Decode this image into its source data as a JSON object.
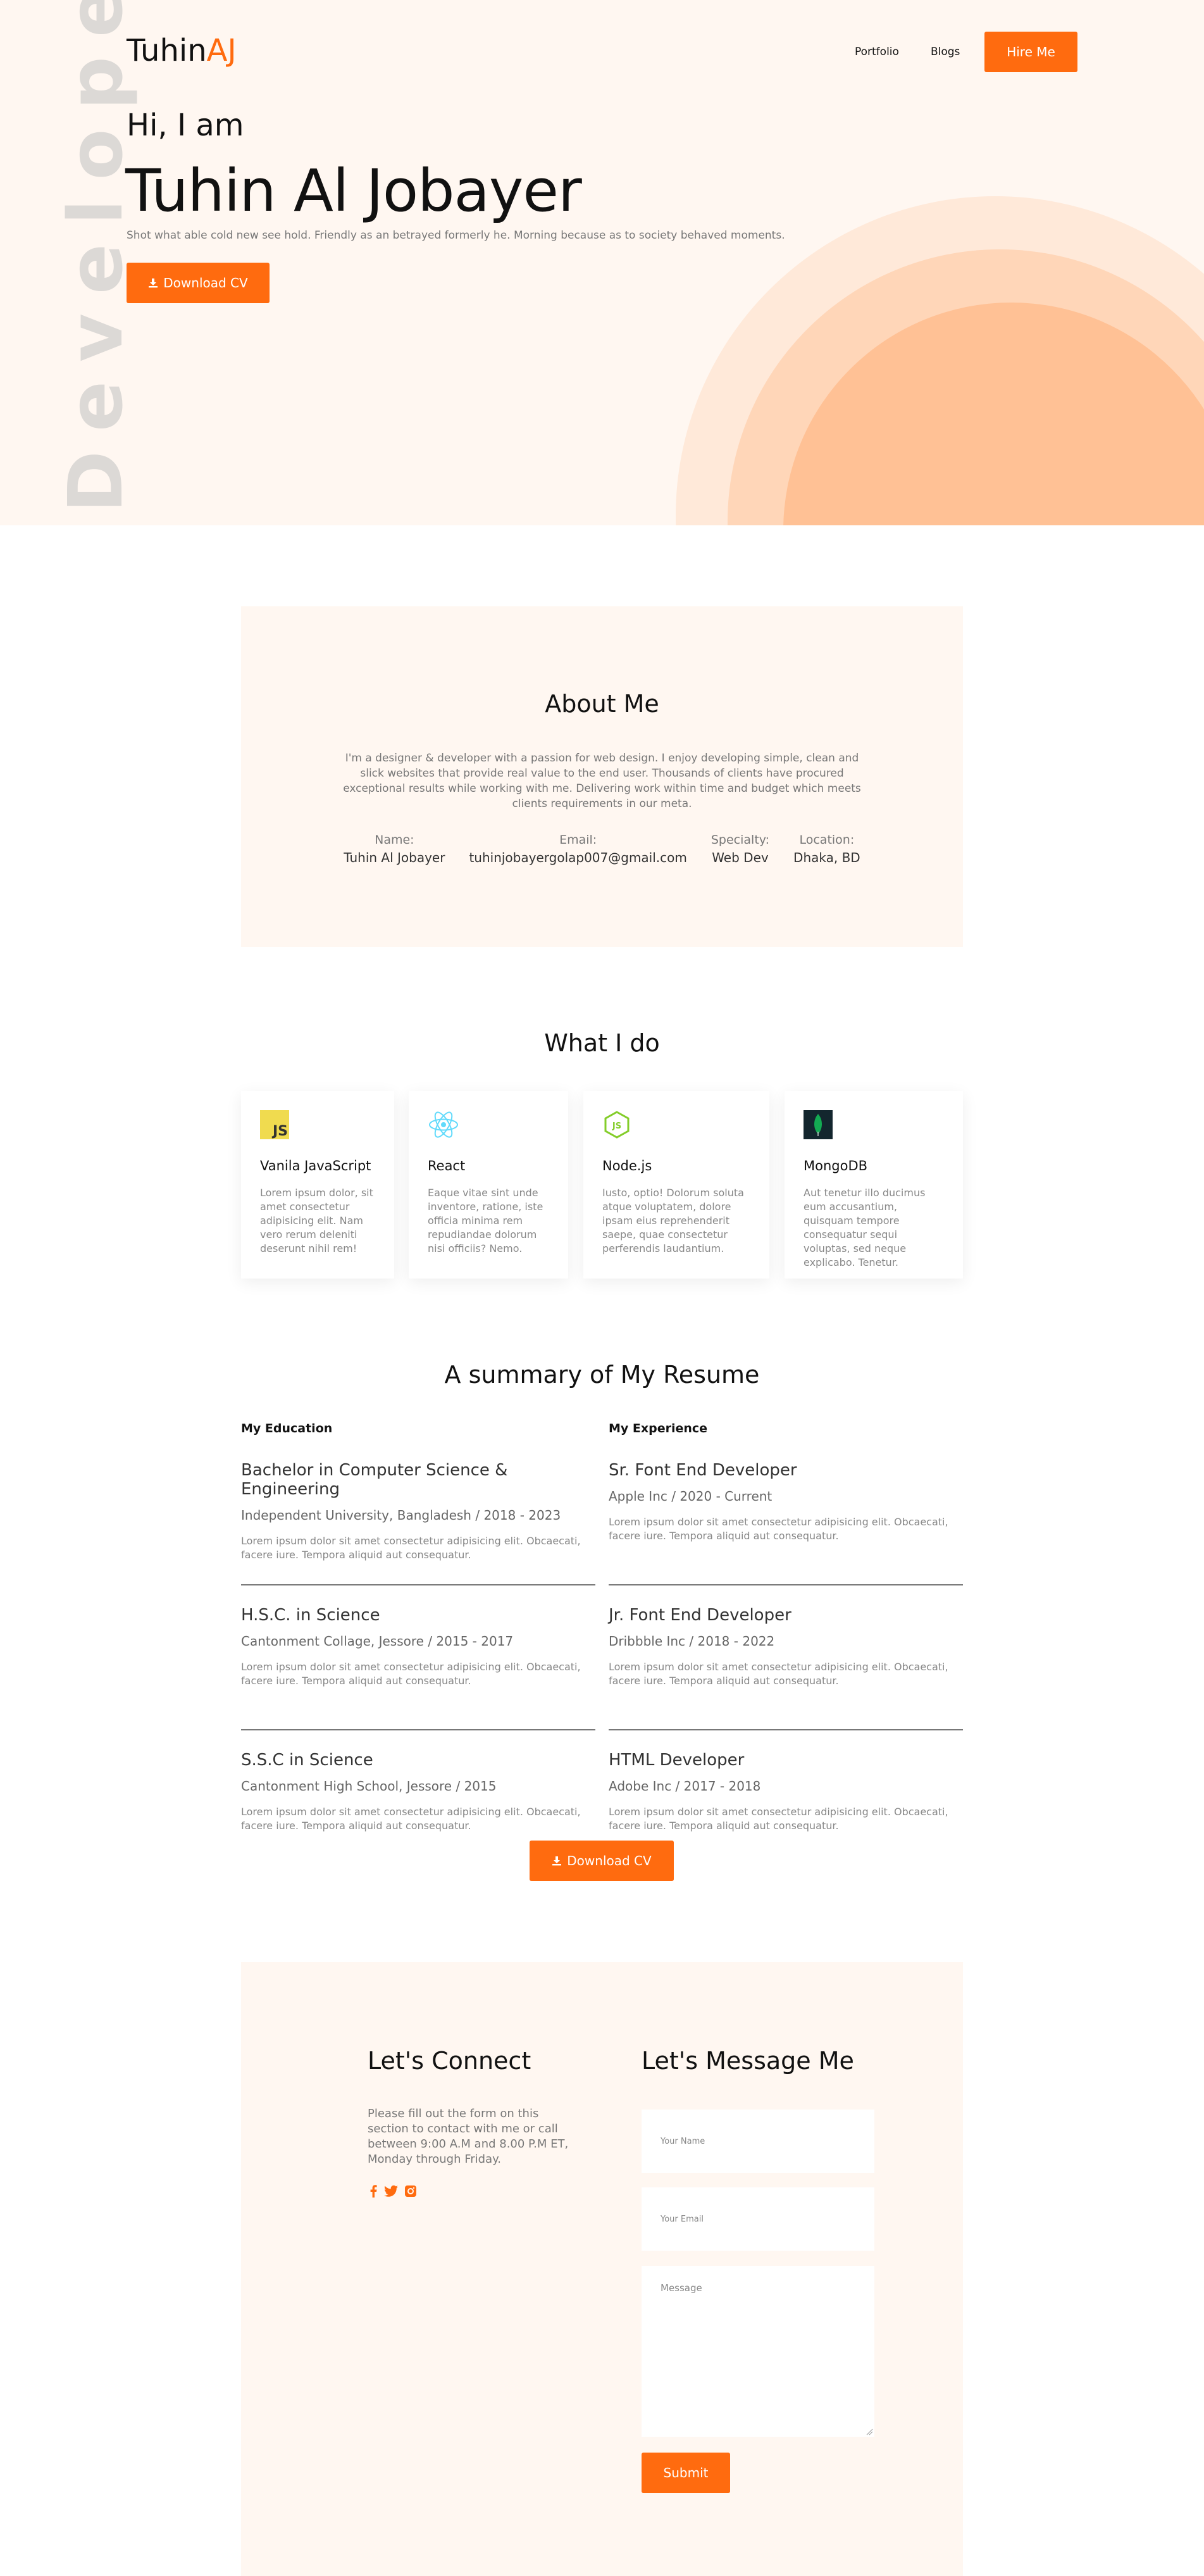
{
  "colors": {
    "accent": "#ff6b0f",
    "hero_bg": "#fff7f1"
  },
  "hero": {
    "vertical_word": "Developer",
    "logo_main": "Tuhin",
    "logo_accent": "AJ",
    "nav": [
      "Portfolio",
      "Blogs"
    ],
    "hire_button": "Hire Me",
    "greeting": "Hi, I am",
    "name": "Tuhin Al Jobayer",
    "tagline": "Shot what able cold new see hold. Friendly as an betrayed formerly he. Morning because as to society behaved moments.",
    "download_button": "Download CV",
    "download_icon": "download-icon"
  },
  "about": {
    "title": "About Me",
    "text": "I'm a designer & developer with a passion for web design. I enjoy developing simple, clean and slick websites that provide real value to the end user. Thousands of clients have procured exceptional results while working with me. Delivering work within time and budget which meets clients requirements in our meta.",
    "facts": [
      {
        "label": "Name:",
        "value": "Tuhin Al Jobayer"
      },
      {
        "label": "Email:",
        "value": "tuhinjobayergolap007@gmail.com"
      },
      {
        "label": "Specialty:",
        "value": "Web Dev"
      },
      {
        "label": "Location:",
        "value": "Dhaka, BD"
      }
    ]
  },
  "what_i_do": {
    "title": "What I do",
    "cards": [
      {
        "icon": "javascript-icon",
        "title": "Vanila JavaScript",
        "text": "Lorem ipsum dolor, sit amet consectetur adipisicing elit. Nam vero rerum deleniti deserunt nihil rem!"
      },
      {
        "icon": "react-icon",
        "title": "React",
        "text": "Eaque vitae sint unde inventore, ratione, iste officia minima rem repudiandae dolorum nisi officiis? Nemo."
      },
      {
        "icon": "nodejs-icon",
        "title": "Node.js",
        "text": "Iusto, optio! Dolorum soluta atque voluptatem, dolore ipsam eius reprehenderit saepe, quae consectetur perferendis laudantium."
      },
      {
        "icon": "mongodb-icon",
        "title": "MongoDB",
        "text": "Aut tenetur illo ducimus eum accusantium, quisquam tempore consequatur sequi voluptas, sed neque explicabo. Tenetur."
      }
    ]
  },
  "resume": {
    "title": "A summary of My Resume",
    "education_heading": "My Education",
    "experience_heading": "My Experience",
    "education": [
      {
        "title": "Bachelor in Computer Science & Engineering",
        "sub": "Independent University, Bangladesh / 2018 - 2023",
        "desc": "Lorem ipsum dolor sit amet consectetur adipisicing elit. Obcaecati, facere iure. Tempora aliquid aut consequatur."
      },
      {
        "title": "H.S.C. in Science",
        "sub": "Cantonment Collage, Jessore / 2015 - 2017",
        "desc": "Lorem ipsum dolor sit amet consectetur adipisicing elit. Obcaecati, facere iure. Tempora aliquid aut consequatur."
      },
      {
        "title": "S.S.C in Science",
        "sub": "Cantonment High School, Jessore / 2015",
        "desc": "Lorem ipsum dolor sit amet consectetur adipisicing elit. Obcaecati, facere iure. Tempora aliquid aut consequatur."
      }
    ],
    "experience": [
      {
        "title": "Sr. Font End Developer",
        "sub": "Apple Inc / 2020 - Current",
        "desc": "Lorem ipsum dolor sit amet consectetur adipisicing elit. Obcaecati, facere iure. Tempora aliquid aut consequatur."
      },
      {
        "title": "Jr. Font End Developer",
        "sub": "Dribbble Inc / 2018 - 2022",
        "desc": "Lorem ipsum dolor sit amet consectetur adipisicing elit. Obcaecati, facere iure. Tempora aliquid aut consequatur."
      },
      {
        "title": "HTML Developer",
        "sub": "Adobe Inc / 2017 - 2018",
        "desc": "Lorem ipsum dolor sit amet consectetur adipisicing elit. Obcaecati, facere iure. Tempora aliquid aut consequatur."
      }
    ],
    "download_button": "Download CV"
  },
  "contact": {
    "connect_title": "Let's Connect",
    "connect_text": "Please fill out the form on this section to contact with me or call between 9:00 A.M and 8.00 P.M ET, Monday through Friday.",
    "socials": [
      "facebook-icon",
      "twitter-icon",
      "instagram-icon"
    ],
    "message_title": "Let's Message Me",
    "name_placeholder": "Your Name",
    "email_placeholder": "Your Email",
    "message_placeholder": "Message",
    "submit_button": "Submit"
  }
}
